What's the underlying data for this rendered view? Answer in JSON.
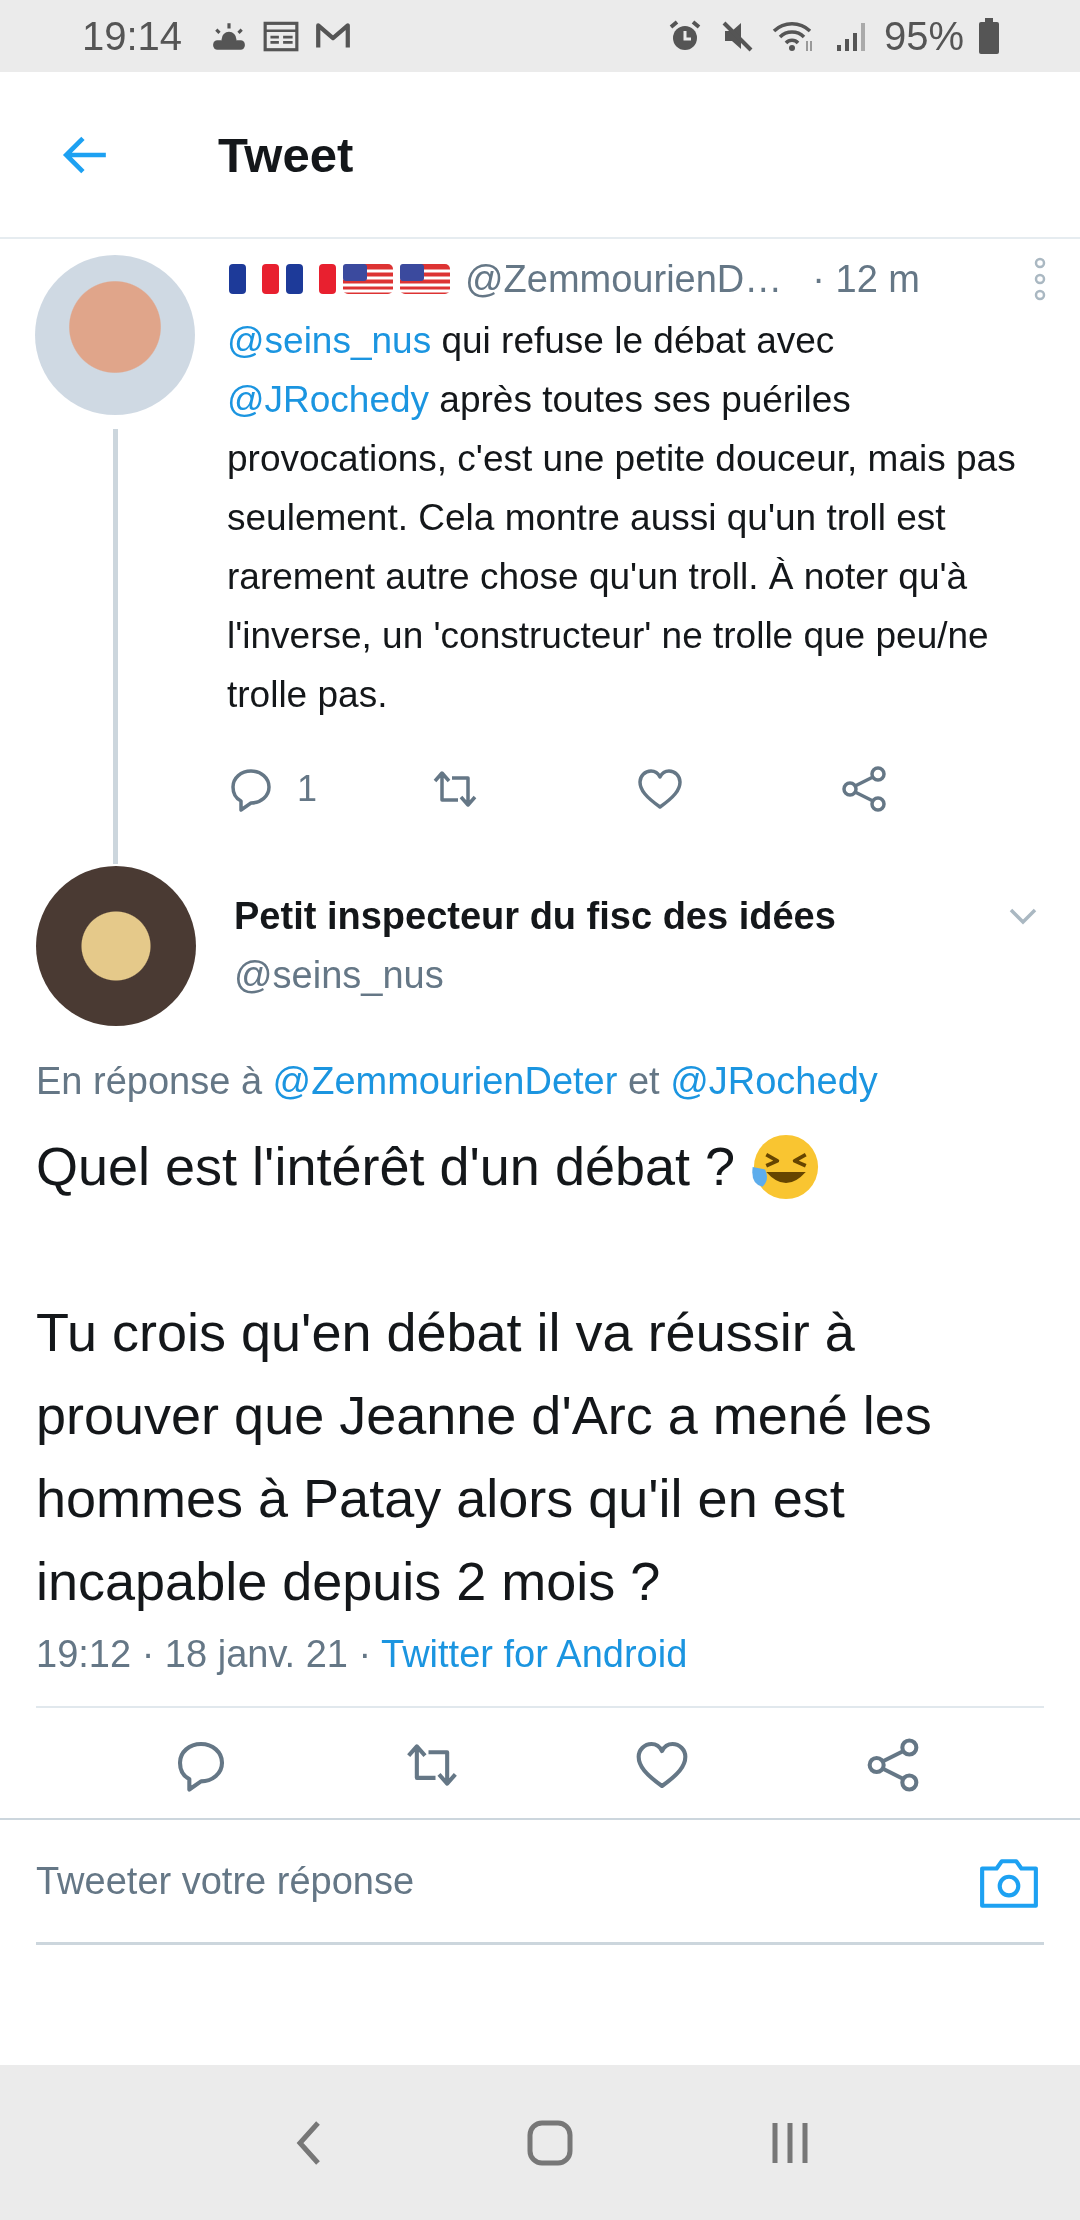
{
  "status_bar": {
    "time": "19:14",
    "battery": "95%"
  },
  "header": {
    "title": "Tweet"
  },
  "parent_tweet": {
    "handle": "@ZemmourienD…",
    "time": "· 12 m",
    "text": [
      {
        "kind": "mention",
        "text": "@seins_nus"
      },
      {
        "kind": "text",
        "text": " qui refuse le débat avec "
      },
      {
        "kind": "mention",
        "text": "@JRochedy"
      },
      {
        "kind": "text",
        "text": " après toutes ses puériles provocations, c'est une petite douceur, mais pas seulement. Cela montre aussi qu'un troll est rarement autre chose qu'un troll. À noter qu'à l'inverse, un 'constructeur' ne trolle que peu/ne trolle pas."
      }
    ],
    "reply_count": "1"
  },
  "tweet": {
    "name": "Petit inspecteur du fisc des idées",
    "handle": "@seins_nus",
    "reply_to": [
      {
        "kind": "text",
        "text": "En réponse à "
      },
      {
        "kind": "mention",
        "text": "@ZemmourienDeter"
      },
      {
        "kind": "text",
        "text": " et "
      },
      {
        "kind": "mention",
        "text": "@JRochedy"
      }
    ],
    "paragraphs": [
      "Quel est l'intérêt d'un débat ?",
      "Tu crois qu'en débat il va réussir à prouver que Jeanne d'Arc a mené les hommes à Patay alors qu'il en est incapable depuis 2 mois ?"
    ],
    "meta": "19:12 · 18 janv. 21 · ",
    "source": "Twitter for Android"
  },
  "reply_field": {
    "placeholder": "Tweeter votre réponse"
  }
}
